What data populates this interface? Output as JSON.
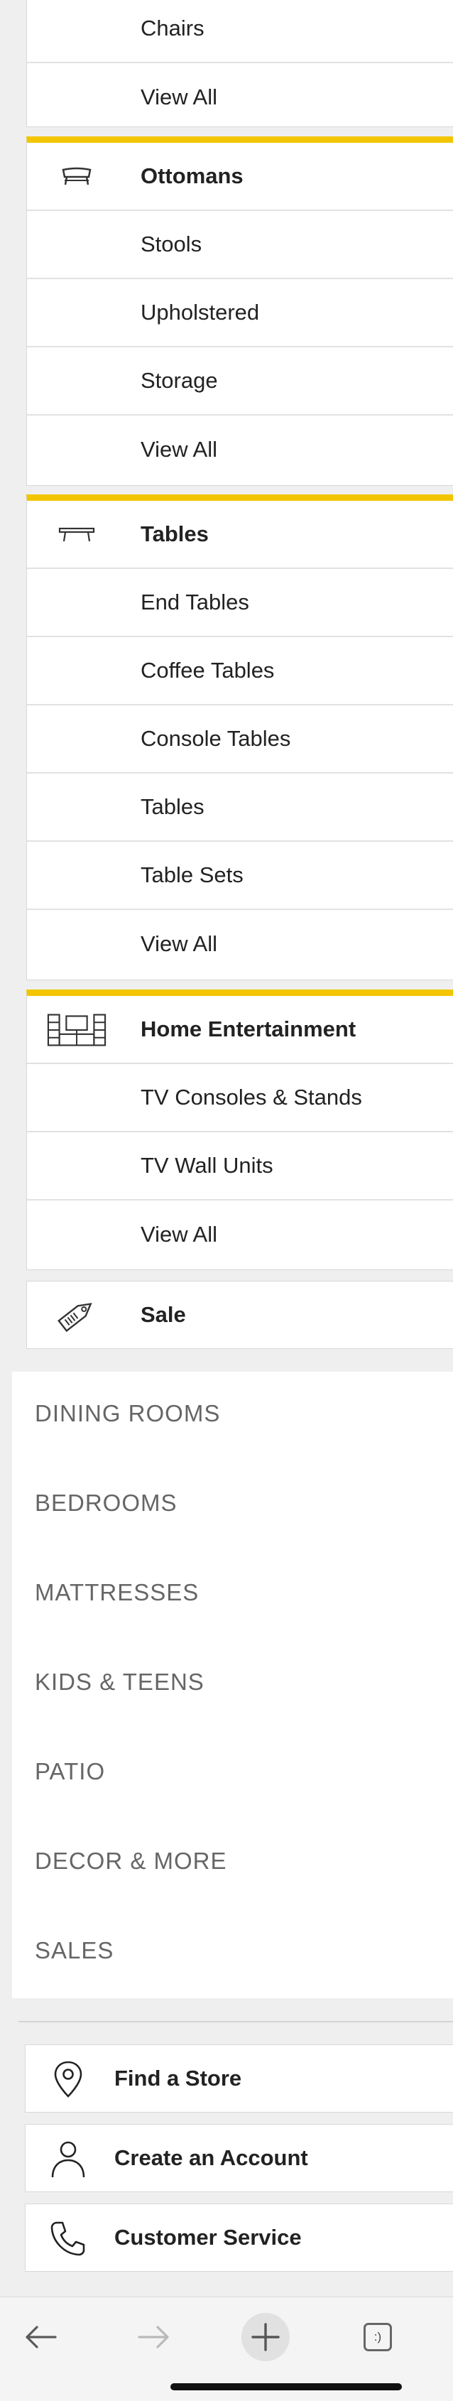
{
  "furniture_menu": {
    "chairs_tail": {
      "items": [
        {
          "label": "Chairs"
        },
        {
          "label": "View All"
        }
      ]
    },
    "ottomans": {
      "heading": "Ottomans",
      "icon": "ottoman-icon",
      "items": [
        {
          "label": "Stools"
        },
        {
          "label": "Upholstered"
        },
        {
          "label": "Storage"
        },
        {
          "label": "View All"
        }
      ]
    },
    "tables": {
      "heading": "Tables",
      "icon": "table-icon",
      "items": [
        {
          "label": "End Tables"
        },
        {
          "label": "Coffee Tables"
        },
        {
          "label": "Console Tables"
        },
        {
          "label": "Tables"
        },
        {
          "label": "Table Sets"
        },
        {
          "label": "View All"
        }
      ]
    },
    "home_entertainment": {
      "heading": "Home Entertainment",
      "icon": "entertainment-center-icon",
      "items": [
        {
          "label": "TV Consoles & Stands"
        },
        {
          "label": "TV Wall Units"
        },
        {
          "label": "View All"
        }
      ]
    },
    "sale": {
      "heading": "Sale",
      "icon": "price-tag-icon"
    }
  },
  "categories": [
    {
      "label": "DINING ROOMS"
    },
    {
      "label": "BEDROOMS"
    },
    {
      "label": "MATTRESSES"
    },
    {
      "label": "KIDS & TEENS"
    },
    {
      "label": "PATIO"
    },
    {
      "label": "DECOR & MORE"
    },
    {
      "label": "SALES"
    }
  ],
  "account_links": [
    {
      "label": "Find a Store",
      "icon": "location-pin-icon"
    },
    {
      "label": "Create an Account",
      "icon": "user-icon"
    },
    {
      "label": "Customer Service",
      "icon": "phone-icon"
    }
  ],
  "browser_toolbar": {
    "back_icon": "back-arrow-icon",
    "forward_icon": "forward-arrow-icon",
    "new_tab_icon": "plus-icon",
    "tabs_icon": "tabs-icon",
    "tabs_text": ":)"
  },
  "colors": {
    "accent_yellow": "#f2c500",
    "panel_bg": "#ffffff",
    "page_bg": "#efefef"
  }
}
